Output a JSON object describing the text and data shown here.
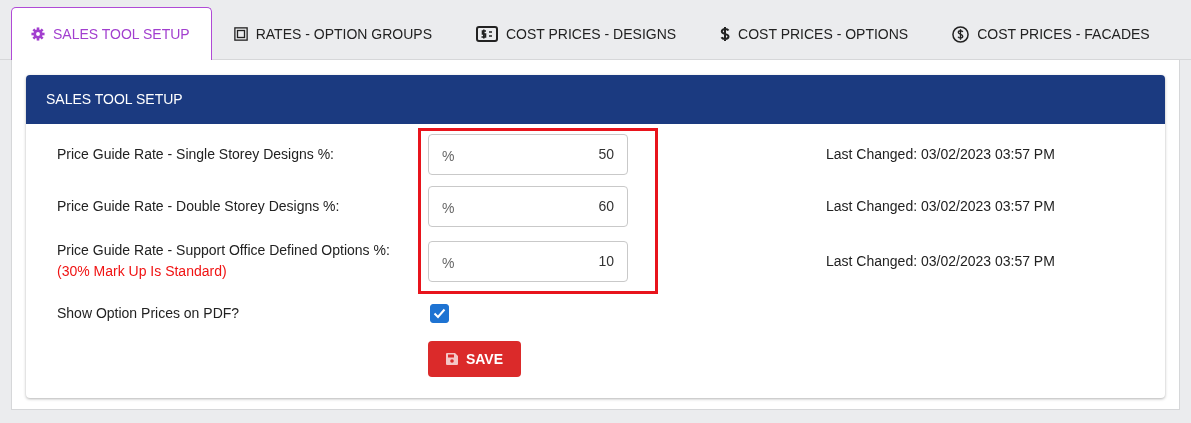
{
  "tabs": [
    {
      "label": "SALES TOOL SETUP",
      "kind": "gear",
      "selected": true
    },
    {
      "label": "RATES - OPTION GROUPS",
      "kind": "frame",
      "selected": false
    },
    {
      "label": "COST PRICES - DESIGNS",
      "kind": "dollar-box",
      "selected": false
    },
    {
      "label": "COST PRICES - OPTIONS",
      "kind": "dollar",
      "selected": false
    },
    {
      "label": "COST PRICES - FACADES",
      "kind": "dollar-circle",
      "selected": false
    }
  ],
  "card": {
    "title": "SALES TOOL SETUP",
    "rates": [
      {
        "label": "Price Guide Rate - Single Storey Designs %:",
        "prefix": "%",
        "value": "50",
        "last_changed": "Last Changed: 03/02/2023 03:57 PM"
      },
      {
        "label": "Price Guide Rate - Double Storey Designs %:",
        "prefix": "%",
        "value": "60",
        "last_changed": "Last Changed: 03/02/2023 03:57 PM"
      },
      {
        "label": "Price Guide Rate - Support Office Defined Options %:",
        "note": "(30% Mark Up Is Standard)",
        "prefix": "%",
        "value": "10",
        "last_changed": "Last Changed: 03/02/2023 03:57 PM"
      }
    ],
    "show_prices": {
      "label": "Show Option Prices on PDF?",
      "checked": true
    },
    "save_button": "SAVE"
  }
}
